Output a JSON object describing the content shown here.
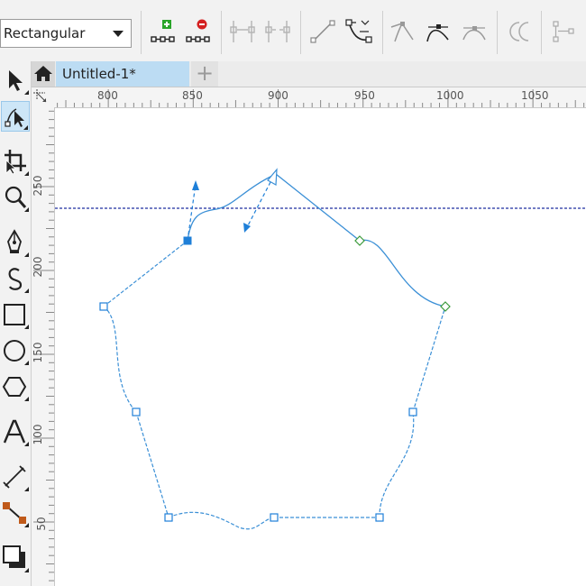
{
  "propbar": {
    "mode_value": "Rectangular"
  },
  "tabs": {
    "document_title": "Untitled-1*",
    "add_tab_glyph": "+"
  },
  "ruler": {
    "horizontal_labels": [
      "800",
      "850",
      "900",
      "950",
      "1000",
      "1050"
    ],
    "vertical_labels": [
      "250",
      "200",
      "150",
      "100",
      "50"
    ]
  },
  "icons": {
    "propbar": [
      "add-node-icon",
      "delete-node-icon",
      "join-nodes-icon",
      "break-curve-icon",
      "to-line-icon",
      "to-curve-icon",
      "cusp-node-icon",
      "smooth-node-icon",
      "symmetrical-node-icon",
      "reverse-direction-icon",
      "extract-subpath-icon"
    ],
    "toolbox": [
      "pick-tool-icon",
      "shape-tool-icon",
      "crop-tool-icon",
      "zoom-tool-icon",
      "pen-tool-icon",
      "artistic-media-icon",
      "rectangle-tool-icon",
      "ellipse-tool-icon",
      "polygon-tool-icon",
      "text-tool-icon",
      "dimension-tool-icon",
      "connector-tool-icon",
      "drop-shadow-icon"
    ]
  },
  "colors": {
    "path_stroke": "#3a8fd6",
    "selected_node": "#1e7fd8",
    "guideline": "#1f2fa0",
    "active_tab": "#bcdcf3",
    "end_node": "#3a9a3a"
  }
}
